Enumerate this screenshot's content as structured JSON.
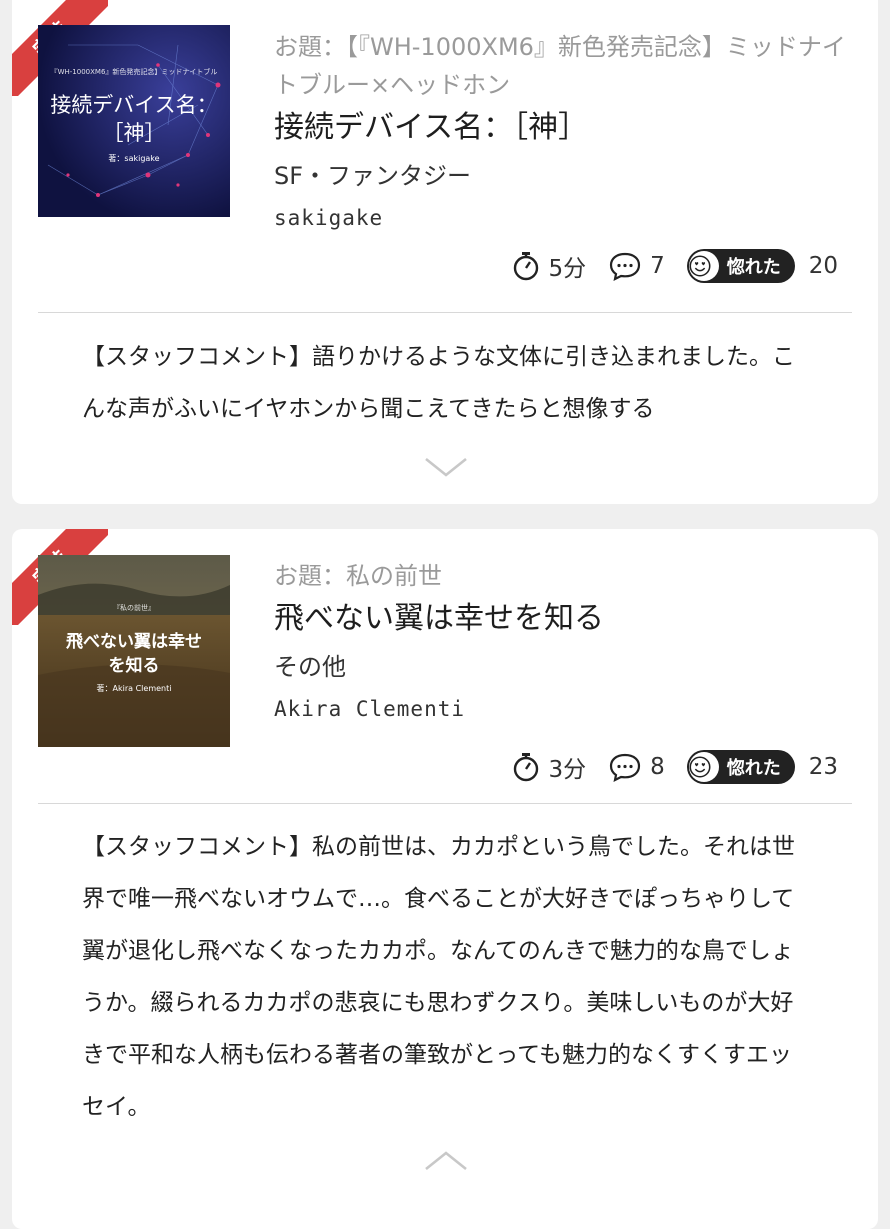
{
  "cards": [
    {
      "badge": "完結",
      "cover": {
        "top_line": "『WH-1000XM6』新色発売記念】ミッドナイトブル",
        "title_line1": "接続デバイス名：",
        "title_line2": "［神］",
        "author_line": "著：sakigake"
      },
      "topic": "お題：【『WH-1000XM6』新色発売記念】ミッドナイトブルー×ヘッドホン",
      "title": "接続デバイス名：［神］",
      "genre": "SF・ファンタジー",
      "author": "sakigake",
      "read_time": "5分",
      "comments": "7",
      "horeta_label": "惚れた",
      "horeta_count": "20",
      "staff_comment": "【スタッフコメント】語りかけるような文体に引き込まれました。こんな声がふいにイヤホンから聞こえてきたらと想像する",
      "toggle_icon": "chevron-down-icon"
    },
    {
      "badge": "完結",
      "cover": {
        "top_line": "『私の前世』",
        "title_line1": "飛べない翼は幸せ",
        "title_line2": "を知る",
        "author_line": "著：Akira Clementi"
      },
      "topic": "お題：私の前世",
      "title": "飛べない翼は幸せを知る",
      "genre": "その他",
      "author": "Akira Clementi",
      "read_time": "3分",
      "comments": "8",
      "horeta_label": "惚れた",
      "horeta_count": "23",
      "staff_comment": "【スタッフコメント】私の前世は、カカポという鳥でした。それは世界で唯一飛べないオウムで…。食べることが大好きでぽっちゃりして翼が退化し飛べなくなったカカポ。なんてのんきで魅力的な鳥でしょうか。綴られるカカポの悲哀にも思わずクスり。美味しいものが大好きで平和な人柄も伝わる著者の筆致がとっても魅力的なくすくすエッセイ。",
      "toggle_icon": "chevron-up-icon"
    }
  ],
  "colors": {
    "badge": "#d9403f",
    "background": "#efefef",
    "card": "#ffffff",
    "topic_text": "#9a9a9a"
  }
}
